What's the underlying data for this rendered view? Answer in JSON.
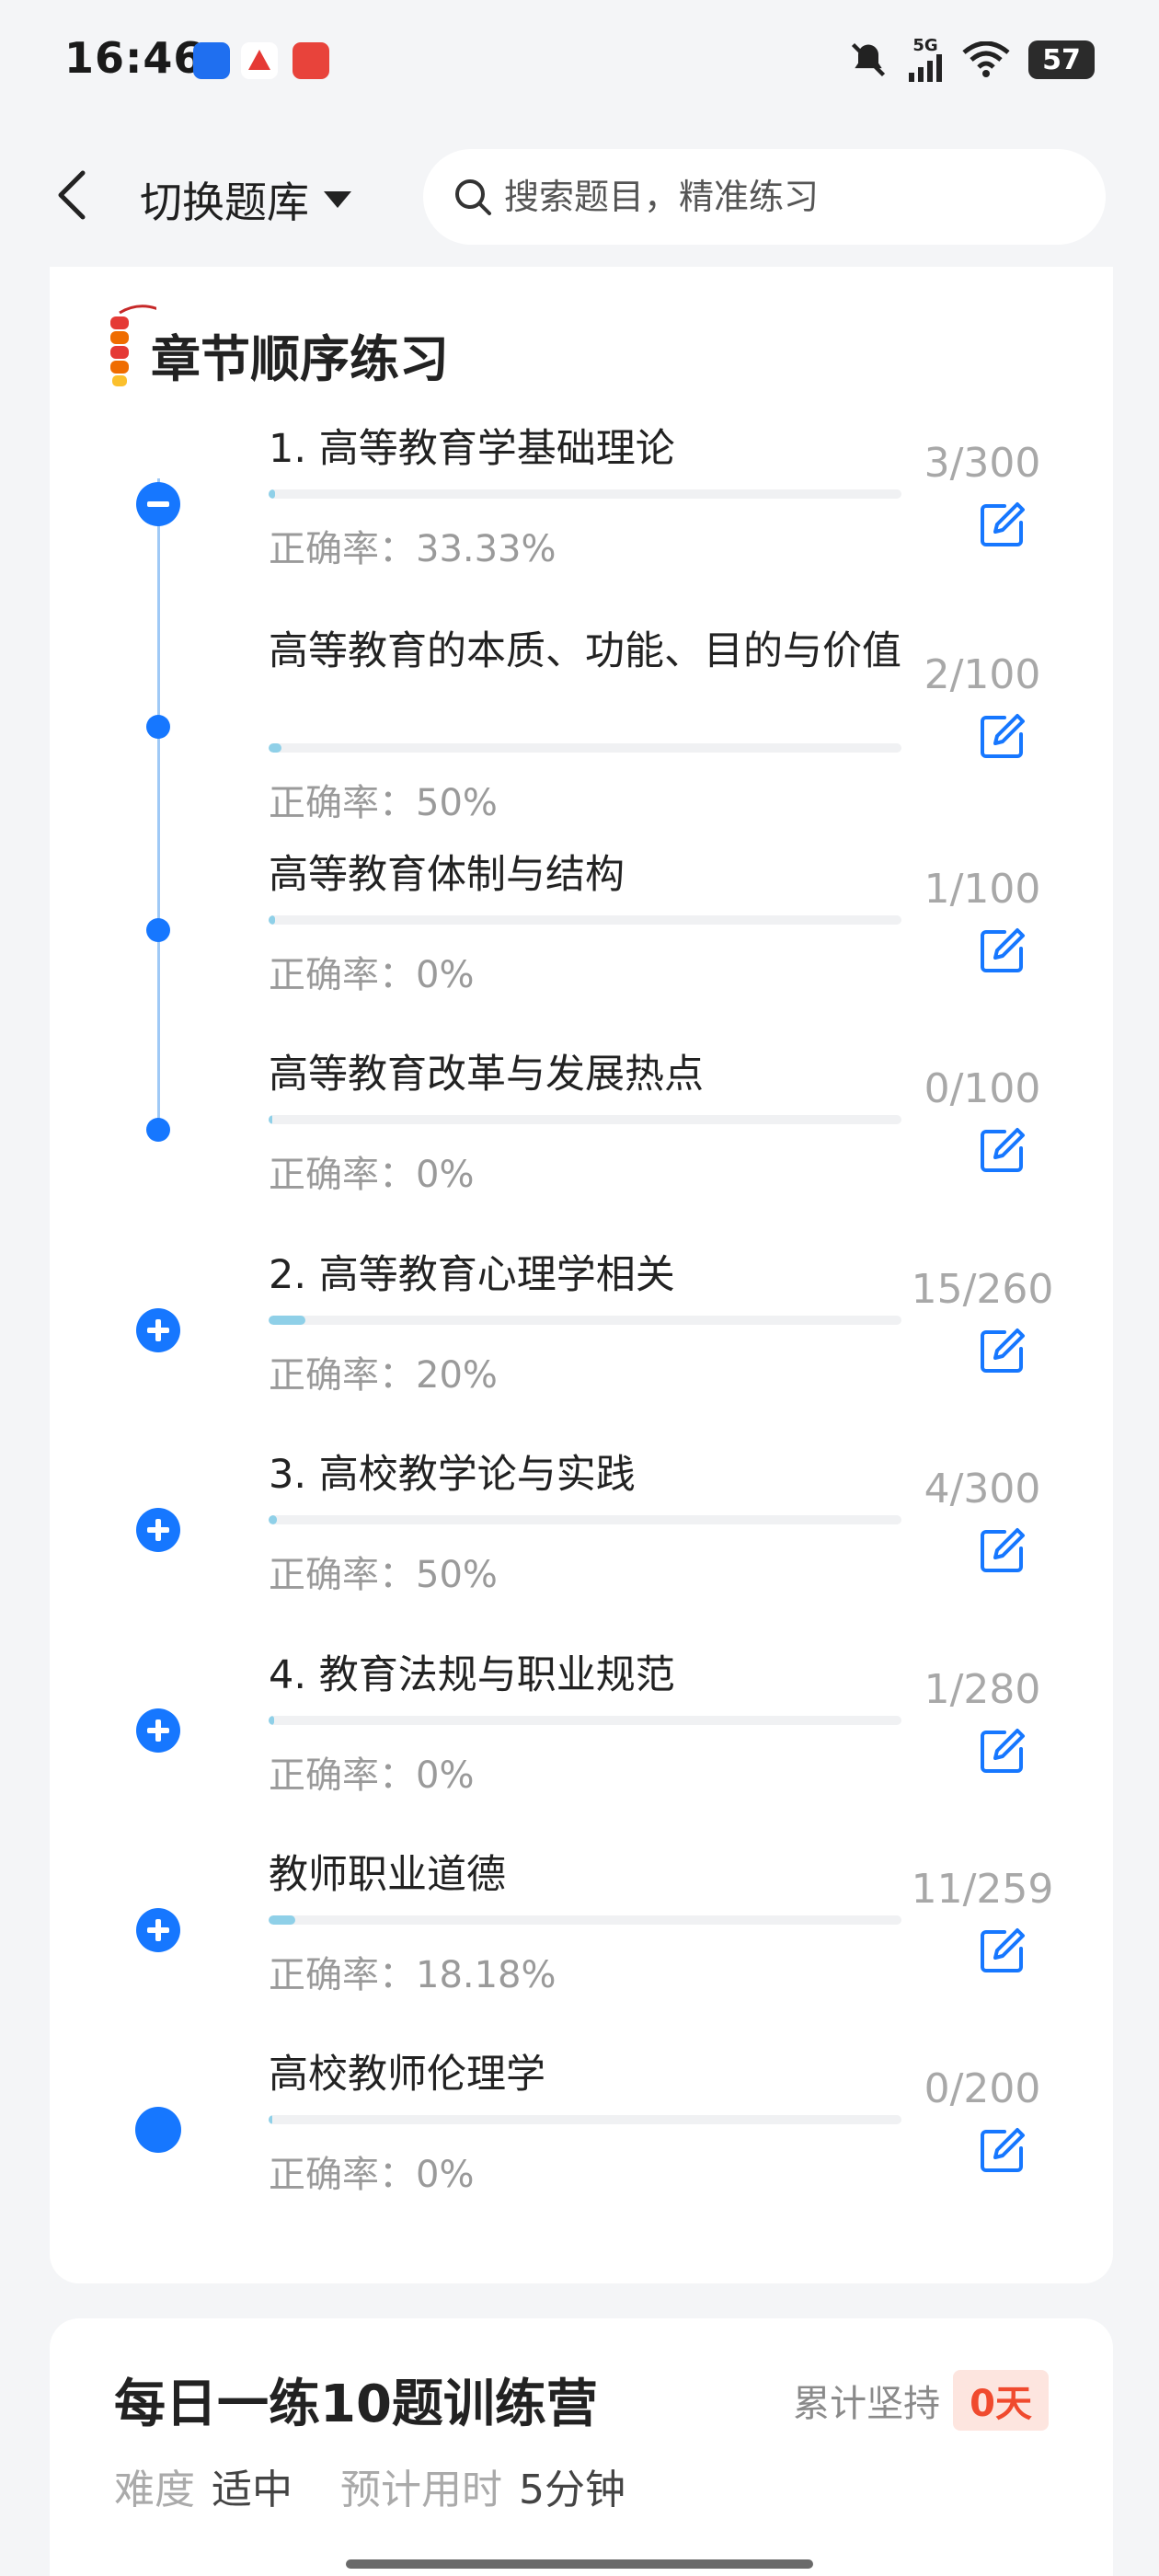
{
  "status": {
    "time": "16:46",
    "network": "5G",
    "battery": "57"
  },
  "header": {
    "switch_label": "切换题库",
    "search_placeholder": "搜索题目，精准练习"
  },
  "section": {
    "title": "章节顺序练习"
  },
  "chapters": [
    {
      "title": "1. 高等教育学基础理论",
      "rate": "正确率：33.33%",
      "count": "3/300",
      "progress": 0.01,
      "marker": "collapse"
    },
    {
      "title": "高等教育的本质、功能、目的与价值",
      "rate": "正确率：50%",
      "count": "2/100",
      "progress": 0.02,
      "marker": "dot"
    },
    {
      "title": "高等教育体制与结构",
      "rate": "正确率：0%",
      "count": "1/100",
      "progress": 0.01,
      "marker": "dot"
    },
    {
      "title": "高等教育改革与发展热点",
      "rate": "正确率：0%",
      "count": "0/100",
      "progress": 0.0,
      "marker": "dot"
    },
    {
      "title": "2. 高等教育心理学相关",
      "rate": "正确率：20%",
      "count": "15/260",
      "progress": 0.058,
      "marker": "expand"
    },
    {
      "title": "3. 高校教学论与实践",
      "rate": "正确率：50%",
      "count": "4/300",
      "progress": 0.013,
      "marker": "expand"
    },
    {
      "title": "4. 教育法规与职业规范",
      "rate": "正确率：0%",
      "count": "1/280",
      "progress": 0.004,
      "marker": "expand"
    },
    {
      "title": "教师职业道德",
      "rate": "正确率：18.18%",
      "count": "11/259",
      "progress": 0.042,
      "marker": "expand"
    },
    {
      "title": "高校教师伦理学",
      "rate": "正确率：0%",
      "count": "0/200",
      "progress": 0.0,
      "marker": "big-dot"
    }
  ],
  "daily": {
    "title": "每日一练10题训练营",
    "persist_label": "累计坚持",
    "persist_days": "0天",
    "difficulty_label": "难度",
    "difficulty_value": "适中",
    "time_label": "预计用时",
    "time_value": "5分钟"
  },
  "colors": {
    "accent": "#1677ff",
    "progress_fill": "#8fd0e8",
    "highlight": "#f04a2e"
  }
}
